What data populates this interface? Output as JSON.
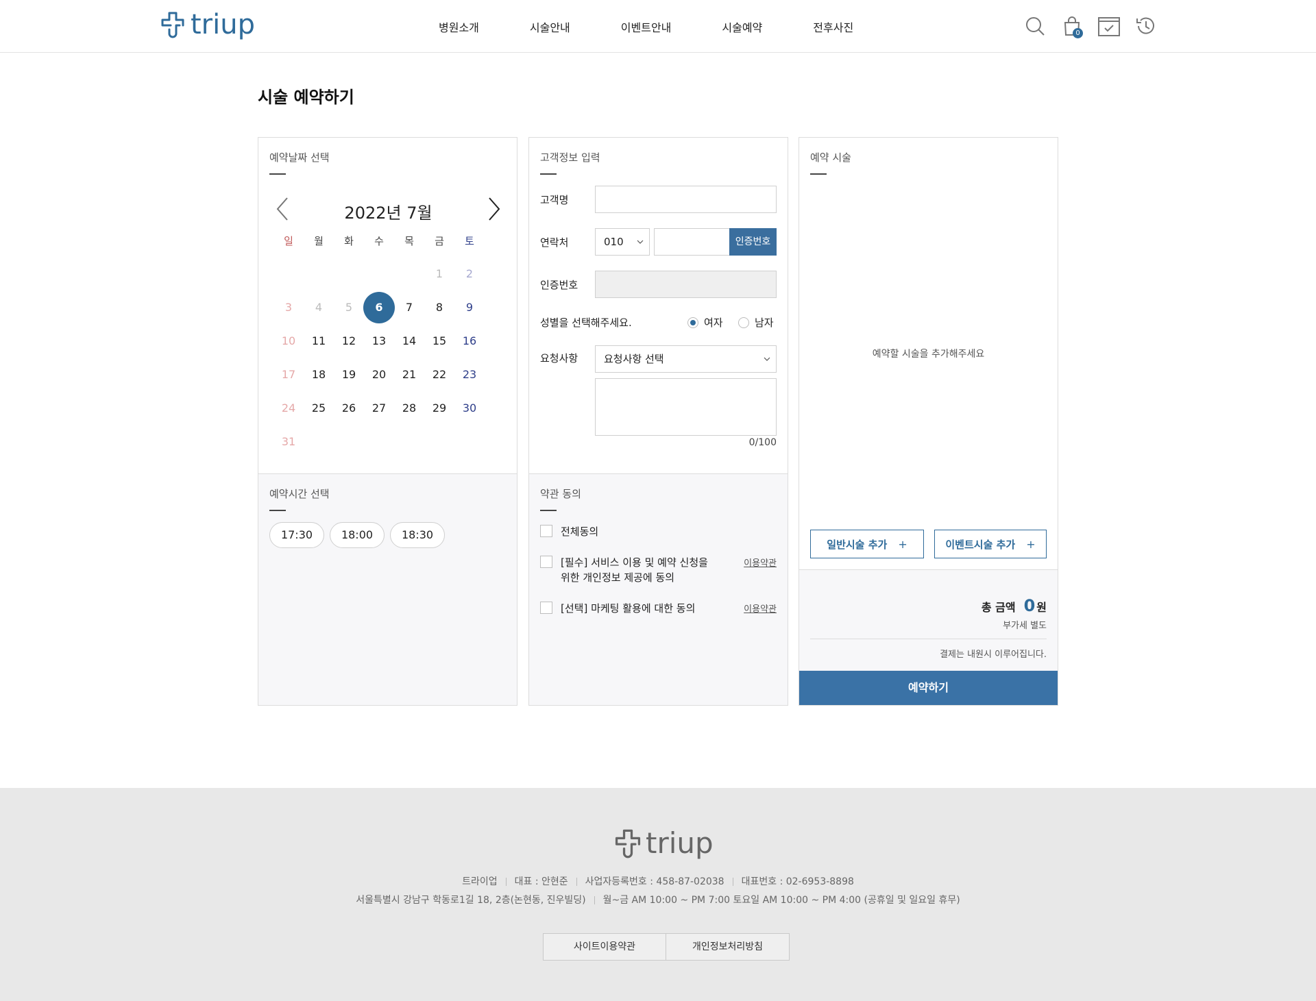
{
  "header": {
    "logo": "triup",
    "nav": [
      "병원소개",
      "시술안내",
      "이벤트안내",
      "시술예약",
      "전후사진"
    ],
    "cart_count": "0",
    "icons": [
      "search-icon",
      "cart-icon",
      "calendar-check-icon",
      "history-icon"
    ]
  },
  "page_title": "시술 예약하기",
  "date_section": {
    "title": "예약날짜 선택",
    "month_label": "2022년 7월",
    "weekdays": [
      "일",
      "월",
      "화",
      "수",
      "목",
      "금",
      "토"
    ],
    "selected_day": 6,
    "weeks": [
      [
        "",
        "",
        "",
        "",
        "",
        "1",
        "2"
      ],
      [
        "3",
        "4",
        "5",
        "6",
        "7",
        "8",
        "9"
      ],
      [
        "10",
        "11",
        "12",
        "13",
        "14",
        "15",
        "16"
      ],
      [
        "17",
        "18",
        "19",
        "20",
        "21",
        "22",
        "23"
      ],
      [
        "24",
        "25",
        "26",
        "27",
        "28",
        "29",
        "30"
      ],
      [
        "31",
        "",
        "",
        "",
        "",
        "",
        ""
      ]
    ],
    "disabled_days": [
      1,
      2,
      3,
      4,
      5,
      10,
      17,
      24,
      31
    ]
  },
  "time_section": {
    "title": "예약시간 선택",
    "times": [
      "17:30",
      "18:00",
      "18:30"
    ]
  },
  "customer": {
    "title": "고객정보 입력",
    "name_label": "고객명",
    "name_value": "",
    "phone_label": "연락처",
    "phone_prefix": "010",
    "phone_value": "",
    "verify_button": "인증번호",
    "code_label": "인증번호",
    "gender_label": "성별을 선택해주세요.",
    "gender_female": "여자",
    "gender_male": "남자",
    "gender_selected": "female",
    "request_label": "요청사항",
    "request_select": "요청사항 선택",
    "request_text": "",
    "counter": "0/100"
  },
  "terms": {
    "title": "약관 동의",
    "all": "전체동의",
    "required_line1": "[필수] 서비스 이용 및 예약 신청을",
    "required_line2": "위한 개인정보 제공에 동의",
    "optional": "[선택] 마케팅 활용에 대한 동의",
    "link": "이용약관"
  },
  "treatment": {
    "title": "예약 시술",
    "empty_message": "예약할 시술을 추가해주세요",
    "add_general": "일반시술 추가",
    "add_event": "이벤트시술 추가",
    "plus": "+",
    "total_label": "총 금액",
    "total_amount": "0",
    "total_unit": "원",
    "vat_note": "부가세 별도",
    "pay_note": "결제는 내원시 이루어집니다.",
    "reserve_button": "예약하기"
  },
  "footer": {
    "logo": "triup",
    "company": "트라이업",
    "ceo": "대표 : 안현준",
    "biz_no": "사업자등록번호 : 458-87-02038",
    "phone": "대표번호 : 02-6953-8898",
    "address": "서울특별시 강남구 학동로1길 18, 2층(논현동, 진우빌딩)",
    "hours": "월~금 AM 10:00 ~ PM 7:00   토요일 AM 10:00 ~ PM 4:00 (공휴일 및 일요일 휴무)",
    "links": [
      "사이트이용약관",
      "개인정보처리방침"
    ]
  },
  "colors": {
    "accent": "#2f6b9a",
    "sunday": "#c05a5a",
    "saturday": "#2f3f8a"
  }
}
